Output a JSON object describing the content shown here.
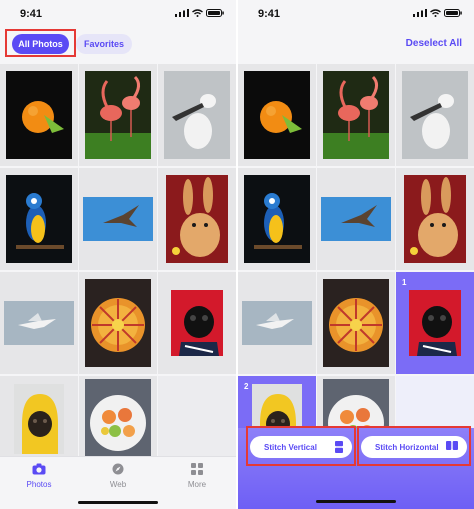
{
  "left_screen": {
    "status_time": "9:41",
    "tabs": {
      "all_photos": "All Photos",
      "favorites": "Favorites"
    },
    "tabbar": [
      {
        "label": "Photos",
        "icon": "camera-icon",
        "active": true
      },
      {
        "label": "Web",
        "icon": "compass-icon",
        "active": false
      },
      {
        "label": "More",
        "icon": "grid-icon",
        "active": false
      }
    ]
  },
  "right_screen": {
    "status_time": "9:41",
    "deselect_label": "Deselect All",
    "selection_numbers": [
      "1",
      "2"
    ],
    "stitch_vertical_label": "Stitch Vertical",
    "stitch_horizontal_label": "Stitch Horizontal"
  },
  "photos": [
    {
      "subject": "orange",
      "icon": "orange-photo"
    },
    {
      "subject": "flamingos",
      "icon": "flamingo-photo"
    },
    {
      "subject": "spoonbill",
      "icon": "spoonbill-photo"
    },
    {
      "subject": "parrot",
      "icon": "parrot-photo"
    },
    {
      "subject": "bird in sky",
      "icon": "bird-photo"
    },
    {
      "subject": "rabbit",
      "icon": "rabbit-photo"
    },
    {
      "subject": "seagull",
      "icon": "seagull-photo"
    },
    {
      "subject": "tart",
      "icon": "tart-photo"
    },
    {
      "subject": "pug",
      "icon": "pug-photo"
    },
    {
      "subject": "dog in hoodie",
      "icon": "dog-hoodie-photo"
    },
    {
      "subject": "fruit bowl",
      "icon": "fruit-bowl-photo"
    }
  ],
  "colors": {
    "accent": "#5a4af4",
    "highlight_red": "#e53935",
    "selection": "#7b6cf6"
  }
}
